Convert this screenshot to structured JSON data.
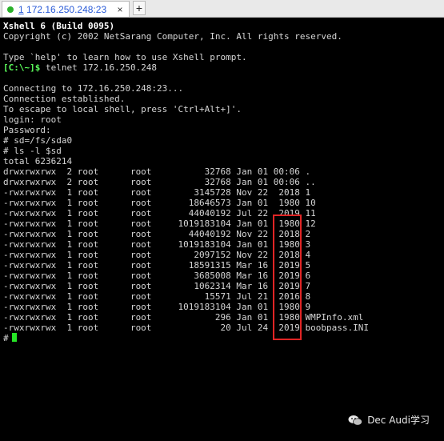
{
  "tab": {
    "number": "1",
    "label": "172.16.250.248:23",
    "close_glyph": "×",
    "new_tab_glyph": "+"
  },
  "terminal": {
    "lines": [
      {
        "text": "Xshell 6 (Build 0095)",
        "style": "bold"
      },
      {
        "text": "Copyright (c) 2002 NetSarang Computer, Inc. All rights reserved.",
        "style": "normal"
      },
      {
        "text": "",
        "style": "normal"
      },
      {
        "text": "Type `help' to learn how to use Xshell prompt.",
        "style": "normal"
      },
      {
        "text": "",
        "style": "prompt_line"
      },
      {
        "text": "",
        "style": "normal"
      },
      {
        "text": "Connecting to 172.16.250.248:23...",
        "style": "normal"
      },
      {
        "text": "Connection established.",
        "style": "normal"
      },
      {
        "text": "To escape to local shell, press 'Ctrl+Alt+]'.",
        "style": "normal"
      },
      {
        "text": "login: root",
        "style": "normal"
      },
      {
        "text": "Password:",
        "style": "normal"
      },
      {
        "text": "# sd=/fs/sda0",
        "style": "normal"
      },
      {
        "text": "# ls -l $sd",
        "style": "normal"
      },
      {
        "text": "total 6236214",
        "style": "normal"
      },
      {
        "text": "drwxrwxrwx  2 root      root          32768 Jan 01 00:06 .",
        "style": "normal"
      },
      {
        "text": "drwxrwxrwx  2 root      root          32768 Jan 01 00:06 ..",
        "style": "normal"
      },
      {
        "text": "-rwxrwxrwx  1 root      root        3145728 Nov 22  2018 1",
        "style": "normal"
      },
      {
        "text": "-rwxrwxrwx  1 root      root       18646573 Jan 01  1980 10",
        "style": "normal"
      },
      {
        "text": "-rwxrwxrwx  1 root      root       44040192 Jul 22  2019 11",
        "style": "normal"
      },
      {
        "text": "-rwxrwxrwx  1 root      root     1019183104 Jan 01  1980 12",
        "style": "normal"
      },
      {
        "text": "-rwxrwxrwx  1 root      root       44040192 Nov 22  2018 2",
        "style": "normal"
      },
      {
        "text": "-rwxrwxrwx  1 root      root     1019183104 Jan 01  1980 3",
        "style": "normal"
      },
      {
        "text": "-rwxrwxrwx  1 root      root        2097152 Nov 22  2018 4",
        "style": "normal"
      },
      {
        "text": "-rwxrwxrwx  1 root      root       18591315 Mar 16  2019 5",
        "style": "normal"
      },
      {
        "text": "-rwxrwxrwx  1 root      root        3685008 Mar 16  2019 6",
        "style": "normal"
      },
      {
        "text": "-rwxrwxrwx  1 root      root        1062314 Mar 16  2019 7",
        "style": "normal"
      },
      {
        "text": "-rwxrwxrwx  1 root      root          15571 Jul 21  2016 8",
        "style": "normal"
      },
      {
        "text": "-rwxrwxrwx  1 root      root     1019183104 Jan 01  1980 9",
        "style": "normal"
      },
      {
        "text": "-rwxrwxrwx  1 root      root            296 Jan 01  1980 WMPInfo.xml",
        "style": "normal"
      },
      {
        "text": "-rwxrwxrwx  1 root      root             20 Jul 24  2019 boobpass.INI",
        "style": "normal"
      }
    ],
    "prompt_text": "[C:\\~]$",
    "prompt_command": " telnet 172.16.250.248",
    "final_prompt": "#"
  },
  "watermark": {
    "text": "Dec Audi学习",
    "icon": "wechat-icon"
  },
  "colors": {
    "background": "#000000",
    "text": "#d6d6d6",
    "prompt": "#5cff5c",
    "cursor": "#26e526",
    "highlight_box": "#e02525",
    "tab_text": "#2a5bd7",
    "tab_dot": "#2ab12a"
  }
}
